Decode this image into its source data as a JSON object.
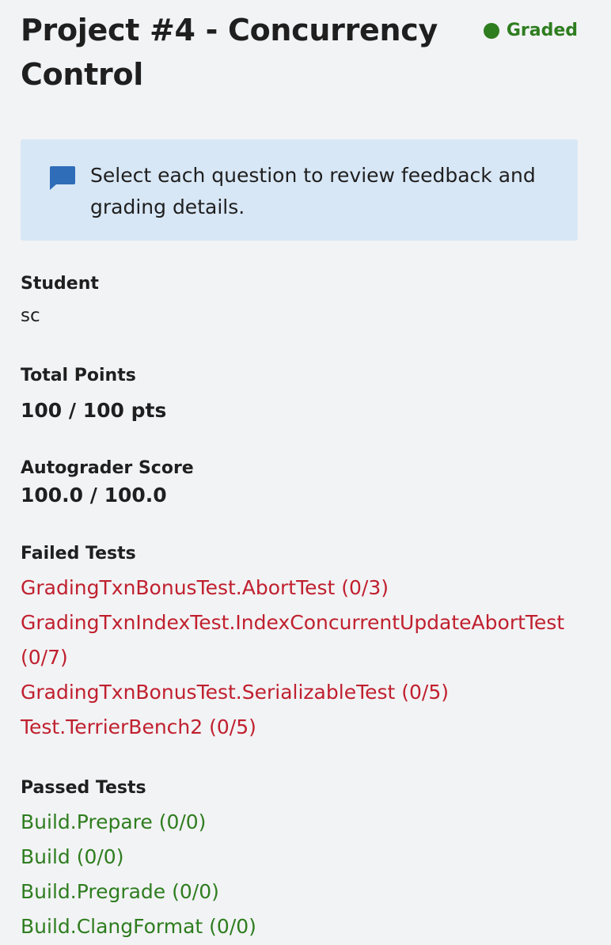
{
  "header": {
    "title": "Project #4 - Concurrency Control",
    "status_label": "Graded",
    "status_color": "#2e7d1f"
  },
  "notice": {
    "icon": "comment-icon",
    "text": "Select each question to review feedback and grading details."
  },
  "student": {
    "label": "Student",
    "value": "sc"
  },
  "total_points": {
    "label": "Total Points",
    "value": "100 / 100 pts"
  },
  "autograder": {
    "label": "Autograder Score",
    "value": "100.0 / 100.0"
  },
  "failed_tests": {
    "label": "Failed Tests",
    "color": "#c0202e",
    "items": [
      "GradingTxnBonusTest.AbortTest (0/3)",
      "GradingTxnIndexTest.IndexConcurrentUpdateAbortTest (0/7)",
      "GradingTxnBonusTest.SerializableTest (0/5)",
      "Test.TerrierBench2 (0/5)"
    ]
  },
  "passed_tests": {
    "label": "Passed Tests",
    "color": "#2e7d1f",
    "items": [
      "Build.Prepare (0/0)",
      "Build (0/0)",
      "Build.Pregrade (0/0)",
      "Build.ClangFormat (0/0)"
    ]
  }
}
